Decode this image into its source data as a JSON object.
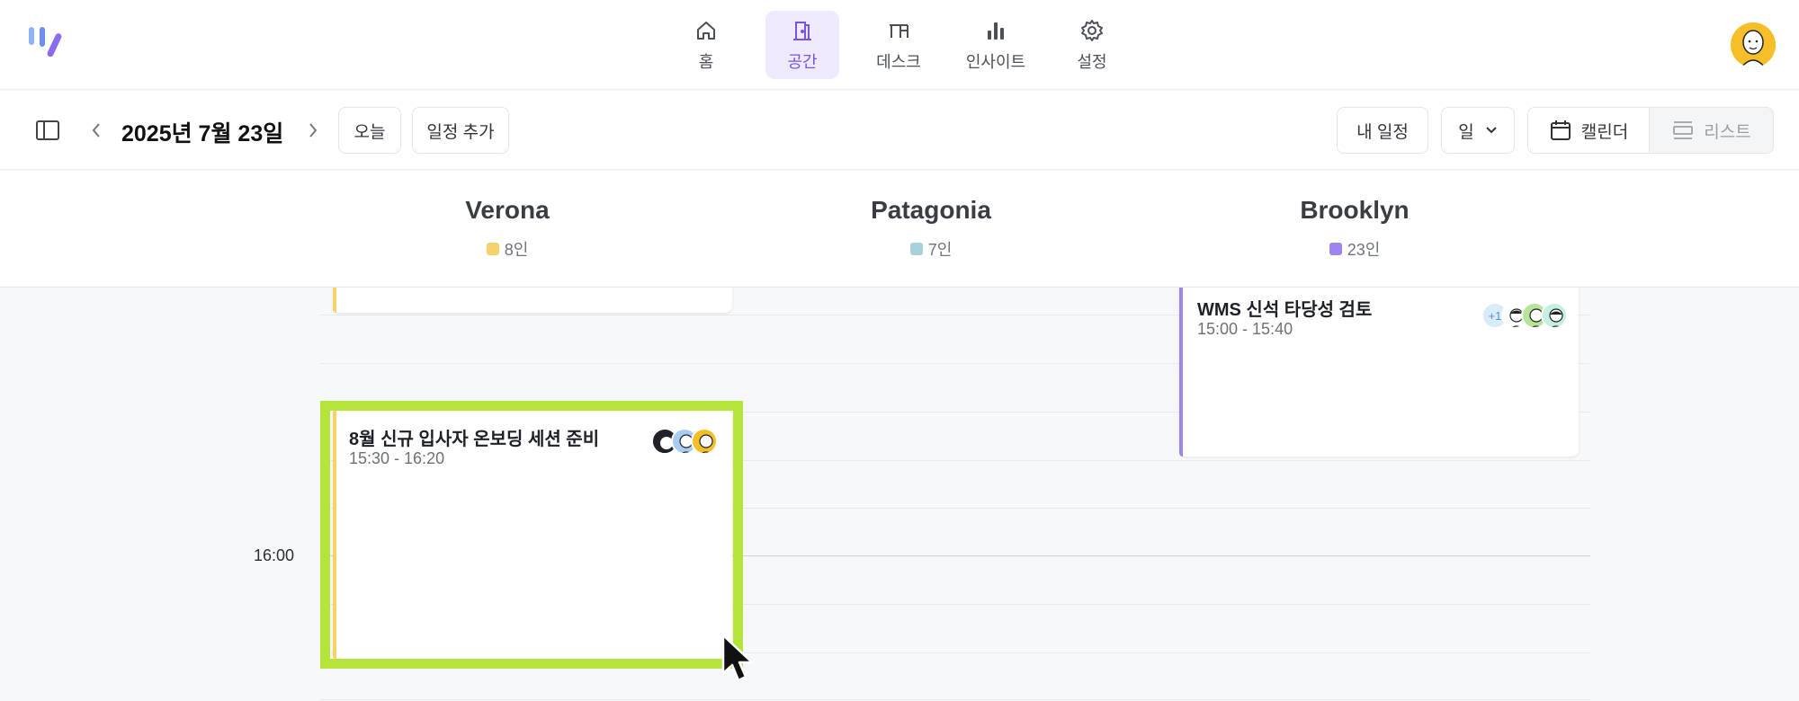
{
  "nav": {
    "items": [
      {
        "label": "홈",
        "icon": "home-icon"
      },
      {
        "label": "공간",
        "icon": "door-icon",
        "active": true
      },
      {
        "label": "데스크",
        "icon": "desk-icon"
      },
      {
        "label": "인사이트",
        "icon": "bar-chart-icon"
      },
      {
        "label": "설정",
        "icon": "gear-icon"
      }
    ],
    "accent": "#7a52e6"
  },
  "toolbar": {
    "date": "2025년 7월 23일",
    "today_label": "오늘",
    "add_label": "일정 추가",
    "my_schedule_label": "내 일정",
    "view_select_value": "일",
    "calendar_label": "캘린더",
    "list_label": "리스트"
  },
  "rooms": [
    {
      "name": "Verona",
      "count": "8인",
      "color": "#f5d36a"
    },
    {
      "name": "Patagonia",
      "count": "7인",
      "color": "#a8d1dc"
    },
    {
      "name": "Brooklyn",
      "count": "23인",
      "color": "#9d85ec"
    }
  ],
  "timeline": {
    "hour_label": "16:00"
  },
  "events": {
    "brooklyn": {
      "title": "WMS 신석 타당성 검토",
      "time": "15:00 - 15:40",
      "extra_attendees": "+1"
    },
    "verona": {
      "title": "8월 신규 입사자 온보딩 세션 준비",
      "time": "15:30 - 16:20"
    }
  }
}
